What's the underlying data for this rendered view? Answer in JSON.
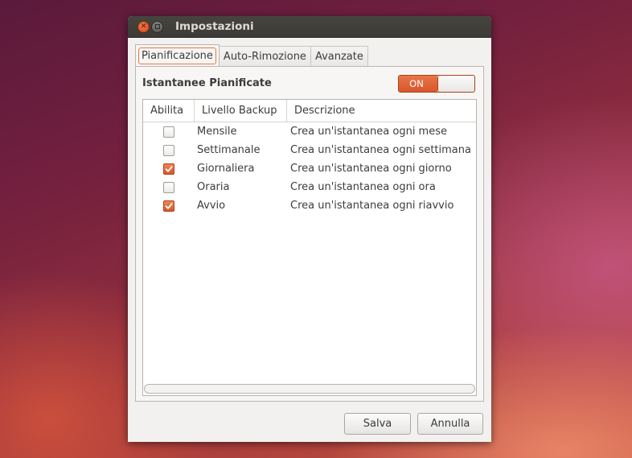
{
  "window": {
    "title": "Impostazioni"
  },
  "tabs": [
    {
      "label": "Pianificazione",
      "active": true
    },
    {
      "label": "Auto-Rimozione",
      "active": false
    },
    {
      "label": "Avanzate",
      "active": false
    }
  ],
  "section": {
    "title": "Istantanee Pianificate"
  },
  "switch": {
    "label": "ON",
    "on": true
  },
  "table": {
    "columns": [
      "Abilita",
      "Livello Backup",
      "Descrizione"
    ],
    "rows": [
      {
        "enabled": false,
        "level": "Mensile",
        "description": "Crea un'istantanea ogni mese"
      },
      {
        "enabled": false,
        "level": "Settimanale",
        "description": "Crea un'istantanea ogni settimana"
      },
      {
        "enabled": true,
        "level": "Giornaliera",
        "description": "Crea un'istantanea ogni giorno"
      },
      {
        "enabled": false,
        "level": "Oraria",
        "description": "Crea un'istantanea ogni ora"
      },
      {
        "enabled": true,
        "level": "Avvio",
        "description": "Crea un'istantanea ogni riavvio"
      }
    ]
  },
  "buttons": {
    "save": "Salva",
    "cancel": "Annulla"
  },
  "colors": {
    "accent": "#dd5a2c",
    "titlebar": "#3c3b37"
  }
}
